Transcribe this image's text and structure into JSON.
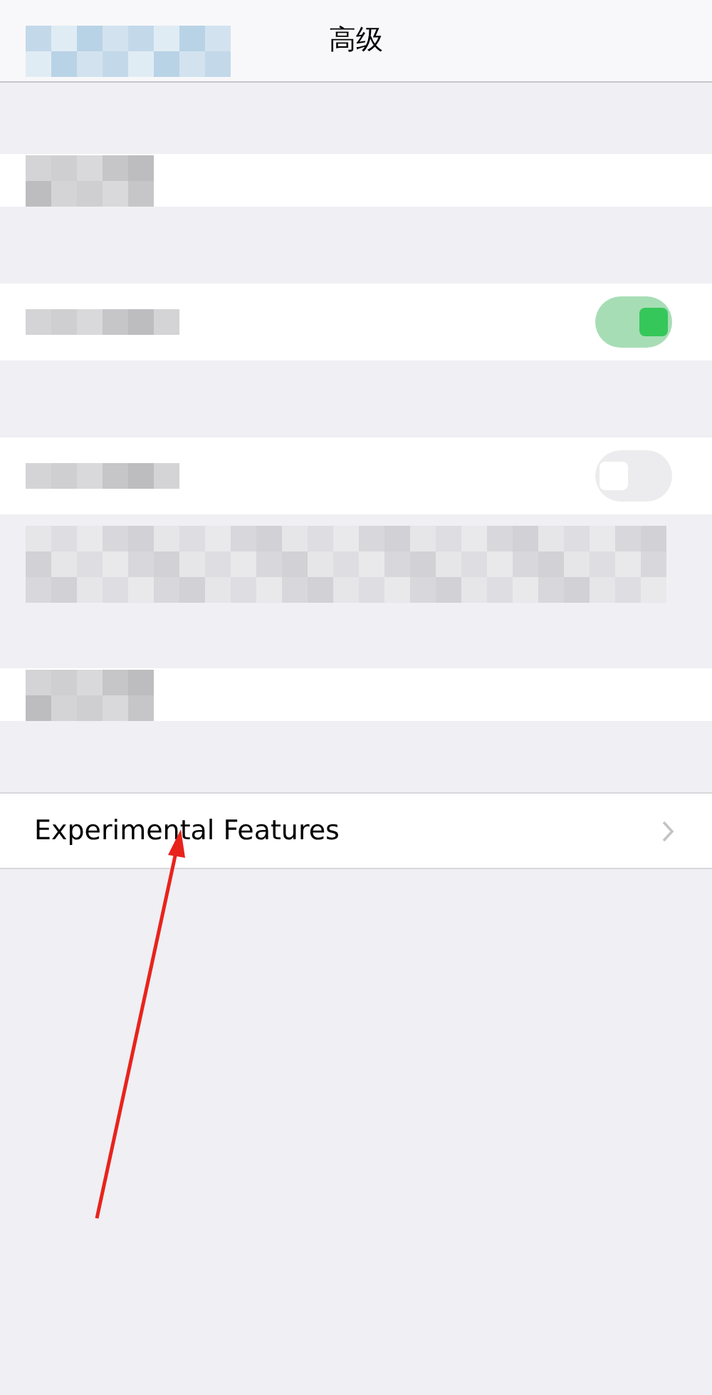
{
  "nav": {
    "title": "高级"
  },
  "rows": [
    {
      "kind": "blurred"
    },
    {
      "kind": "toggle",
      "on": true
    },
    {
      "kind": "toggle",
      "on": false
    },
    {
      "kind": "note"
    },
    {
      "kind": "blurred"
    },
    {
      "kind": "link",
      "label": "Experimental Features"
    }
  ],
  "annotation": {
    "kind": "arrow"
  }
}
